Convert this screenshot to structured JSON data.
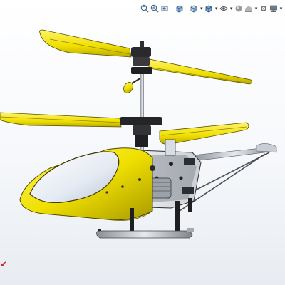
{
  "toolbar": {
    "buttons": [
      {
        "icon": "zoom-to-fit-icon"
      },
      {
        "icon": "zoom-to-area-icon"
      },
      {
        "icon": "previous-view-icon"
      },
      {
        "icon": "section-view-icon"
      },
      {
        "icon": "view-orientation-icon"
      },
      {
        "icon": "display-style-icon"
      },
      {
        "icon": "hide-show-items-icon"
      },
      {
        "icon": "edit-appearance-icon"
      },
      {
        "icon": "apply-scene-icon"
      },
      {
        "icon": "view-settings-icon"
      },
      {
        "icon": "monitor-icon"
      }
    ]
  },
  "model": {
    "colors": {
      "body": "#f3e300",
      "body_shade": "#b8a800",
      "canopy": "#e9eef5",
      "frame": "#5a5d62",
      "frame_dark": "#1c1c1e",
      "board": "#2f7a3c"
    }
  }
}
